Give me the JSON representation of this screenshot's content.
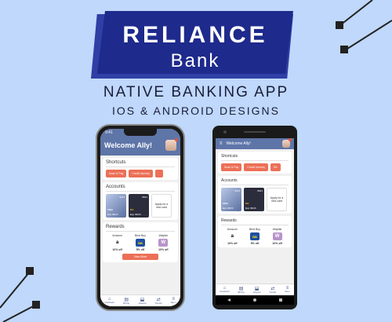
{
  "banner": {
    "title": "RELIANCE",
    "subtitle": "Bank"
  },
  "headline": "NATIVE BANKING APP",
  "subline": "IOS & ANDROID DESIGNS",
  "colors": {
    "background": "#bfd8fb",
    "banner": "#1e2a8c",
    "header": "#5e75a8",
    "accent": "#ec7057"
  },
  "iphone": {
    "time": "9:41",
    "welcome": "Welcome Ally!",
    "shortcuts_title": "Shortcuts",
    "shortcuts": [
      "Scan & Pay",
      "Credit Journey"
    ],
    "accounts_title": "Accounts",
    "cards": [
      {
        "number": "9413",
        "brand": "VISA",
        "expiry": "Exp 08/23"
      },
      {
        "number": "8921",
        "brand": "MC",
        "expiry": "Exp 09/20"
      }
    ],
    "apply": "Apply for a new card",
    "rewards_title": "Rewards",
    "rewards": [
      {
        "name": "Amazon",
        "logo": "a",
        "offer": "10% off"
      },
      {
        "name": "Best Buy",
        "logo": "BB",
        "offer": "5% off"
      },
      {
        "name": "Wayfair",
        "logo": "W",
        "offer": "10% off"
      }
    ],
    "view_more": "View More",
    "tabs": [
      {
        "label": "Dashboard",
        "icon": "home-icon"
      },
      {
        "label": "Bill Pay",
        "icon": "bill-icon"
      },
      {
        "label": "eDeposit",
        "icon": "deposit-icon"
      },
      {
        "label": "Transfer",
        "icon": "transfer-icon"
      },
      {
        "label": "Menu",
        "icon": "menu-icon"
      }
    ]
  },
  "android": {
    "welcome": "Welcome Ally!",
    "shortcuts_title": "Shortcuts",
    "shortcuts": [
      "Scan & Pay",
      "Credit Journey",
      "Re"
    ],
    "accounts_title": "Accounts",
    "cards": [
      {
        "number": "9413",
        "brand": "VISA",
        "expiry": "Exp 08/23"
      },
      {
        "number": "8921",
        "brand": "MC",
        "expiry": "Exp 09/20"
      }
    ],
    "apply": "Apply for a new card",
    "rewards_title": "Rewards",
    "rewards": [
      {
        "name": "Amazon",
        "logo": "a",
        "offer": "10% off"
      },
      {
        "name": "Best Buy",
        "logo": "BB",
        "offer": "5% off"
      },
      {
        "name": "Wayfair",
        "logo": "W",
        "offer": "10% off"
      }
    ],
    "tabs": [
      {
        "label": "Dashboard",
        "icon": "home-icon"
      },
      {
        "label": "Bill Pay",
        "icon": "bill-icon"
      },
      {
        "label": "eDeposit",
        "icon": "deposit-icon"
      },
      {
        "label": "Transfer",
        "icon": "transfer-icon"
      },
      {
        "label": "Menu",
        "icon": "menu-icon"
      }
    ]
  }
}
